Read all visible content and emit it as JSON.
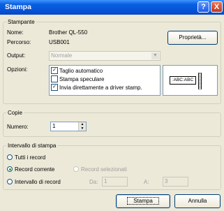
{
  "window": {
    "title": "Stampa"
  },
  "titlebar": {
    "help_glyph": "?",
    "close_glyph": "X"
  },
  "printer_group": {
    "legend": "Stampante",
    "name_label": "Nome:",
    "name_value": "Brother QL-550",
    "path_label": "Percorso:",
    "path_value": "USB001",
    "properties_button": "Proprietà...",
    "output_label": "Output:",
    "output_value": "Normale",
    "options_label": "Opzioni:",
    "options": [
      {
        "label": "Taglio automatico",
        "checked": true
      },
      {
        "label": "Stampa speculare",
        "checked": false
      },
      {
        "label": "Invia direttamente a driver stamp.",
        "checked": true
      }
    ],
    "preview_text": ":ABC:ABC"
  },
  "copies_group": {
    "legend": "Copie",
    "number_label": "Numero:",
    "number_value": "1"
  },
  "range_group": {
    "legend": "Intervallo di stampa",
    "all_records": "Tutti i record",
    "current_record": "Record corrente",
    "selected_records": "Record selezionati",
    "record_range": "Intervallo di record",
    "from_label": "Da:",
    "from_value": "1",
    "to_label": "A:",
    "to_value": "3"
  },
  "buttons": {
    "print": "Stampa",
    "cancel": "Annulla"
  }
}
